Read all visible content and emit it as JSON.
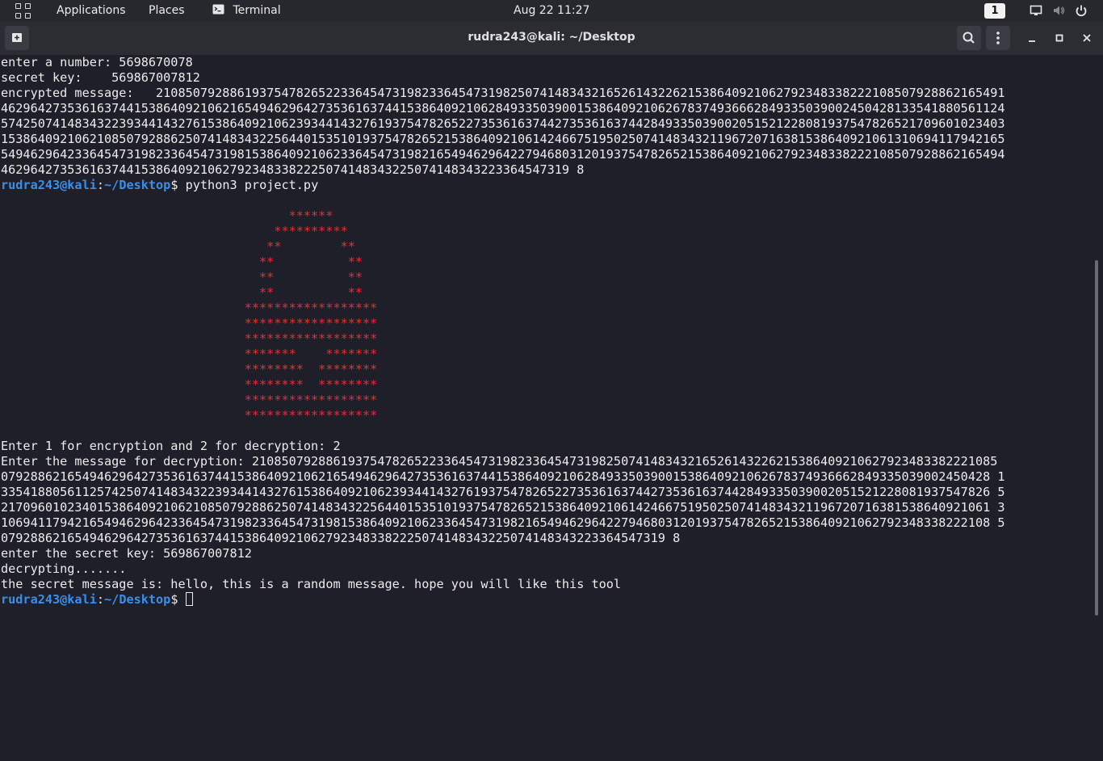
{
  "top_panel": {
    "applications": "Applications",
    "places": "Places",
    "terminal": "Terminal",
    "clock": "Aug 22  11:27",
    "workspace": "1",
    "icons": [
      "apps-grid-icon",
      "terminal-app-icon",
      "screen-icon",
      "volume-muted-icon",
      "power-icon"
    ]
  },
  "titlebar": {
    "title": "rudra243@kali: ~/Desktop"
  },
  "prompt": {
    "user_host": "rudra243@kali",
    "colon": ":",
    "path": "~/Desktop",
    "dollar": "$"
  },
  "terminal": {
    "lines_top": [
      "enter a number: 5698670078",
      "secret key:    569867007812",
      "encrypted message:   2108507928861937547826522336454731982336454731982507414834321652614322621538640921062792348338222108507928862165491",
      "4629642735361637441538640921062165494629642735361637441538640921062849335039001538640921062678374936662849335039002450428133541880561124",
      "5742507414834322393441432761538640921062393441432761937547826522735361637442735361637442849335039002051521228081937547826521709601023403",
      "1538640921062108507928862507414834322564401535101937547826521538640921061424667519502507414834321196720716381538640921061310694117942165",
      "5494629642336454731982336454731981538640921062336454731982165494629642279468031201937547826521538640921062792348338222108507928862165494",
      "46296427353616374415386409210627923483382225074148343225074148343223364547319 8"
    ],
    "command": " python3 project.py",
    "ascii_art": [
      "                                       ******",
      "                                     **********",
      "                                    **        **",
      "                                   **          **",
      "                                   **          **",
      "                                   **          **",
      "                                 ******************",
      "                                 ******************",
      "                                 ******************",
      "                                 *******    *******",
      "                                 ********  ********",
      "                                 ********  ********",
      "                                 ******************",
      "                                 ******************"
    ],
    "lines_bottom": [
      "Enter 1 for encryption and 2 for decryption: 2",
      "Enter the message for decryption: 21085079288619375478265223364547319823364547319825074148343216526143226215386409210627923483382221085",
      "07928862165494629642735361637441538640921062165494629642735361637441538640921062849335039001538640921062678374936662849335039002450428 1",
      "33541880561125742507414834322393441432761538640921062393441432761937547826522735361637442735361637442849335039002051521228081937547826 5",
      "21709601023401538640921062108507928862507414834322564401535101937547826521538640921061424667519502507414834321196720716381538640921061 3",
      "10694117942165494629642336454731982336454731981538640921062336454731982165494629642279468031201937547826521538640921062792348338222108 5",
      "079288621654946296427353616374415386409210627923483382225074148343225074148343223364547319 8",
      "enter the secret key: 569867007812",
      "decrypting.......",
      "the secret message is: hello, this is a random message. hope you will like this tool"
    ]
  }
}
